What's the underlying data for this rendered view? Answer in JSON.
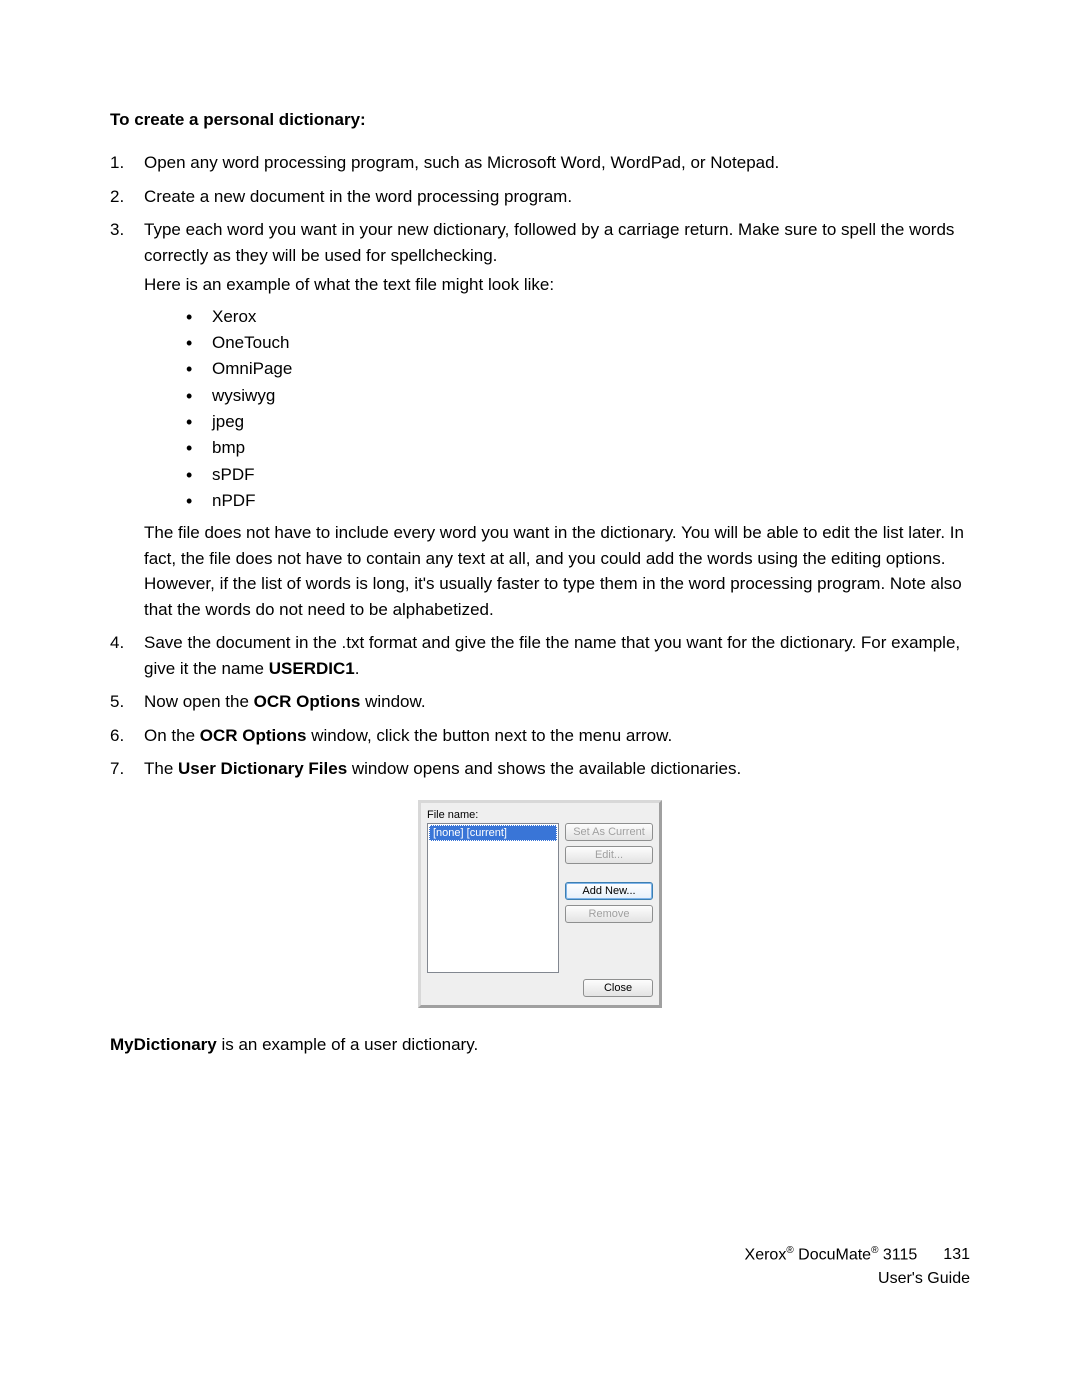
{
  "heading": "To create a personal dictionary:",
  "steps": {
    "s1": "Open any word processing program, such as Microsoft Word, WordPad, or Notepad.",
    "s2": "Create a new document in the word processing program.",
    "s3a": "Type each word you want in your new dictionary, followed by a carriage return. Make sure to spell the words correctly as they will be used for spellchecking.",
    "s3b": "Here is an example of what the text file might look like:",
    "bullets": {
      "b1": "Xerox",
      "b2": "OneTouch",
      "b3": "OmniPage",
      "b4": "wysiwyg",
      "b5": "jpeg",
      "b6": "bmp",
      "b7": "sPDF",
      "b8": "nPDF"
    },
    "s3c": "The file does not have to include every word you want in the dictionary. You will be able to edit the list later. In fact, the file does not have to contain any text at all, and you could add the words using the editing options. However, if the list of words is long, it's usually faster to type them in the word processing program. Note also that the words do not need to be alphabetized.",
    "s4a": "Save the document in the .txt format and give the file the name that you want for the dictionary. For example, give it the name ",
    "s4b": "USERDIC1",
    "s4c": ".",
    "s5a": "Now open the ",
    "s5b": "OCR Options",
    "s5c": " window.",
    "s6a": "On the ",
    "s6b": "OCR Options",
    "s6c": " window, click the button next to the menu arrow.",
    "s7a": "The ",
    "s7b": "User Dictionary Files",
    "s7c": " window opens and shows the available dictionaries."
  },
  "dialog": {
    "filename_label": "File name:",
    "list_item": "[none] [current]",
    "btn_set_current": "Set As Current",
    "btn_edit": "Edit...",
    "btn_add_new": "Add New...",
    "btn_remove": "Remove",
    "btn_close": "Close"
  },
  "closing": {
    "a": "MyDictionary",
    "b": " is an example of a user dictionary."
  },
  "footer": {
    "brand1": "Xerox",
    "reg": "®",
    "brand2": " DocuMate",
    "model": " 3115",
    "page_num": "131",
    "guide": "User's Guide"
  }
}
